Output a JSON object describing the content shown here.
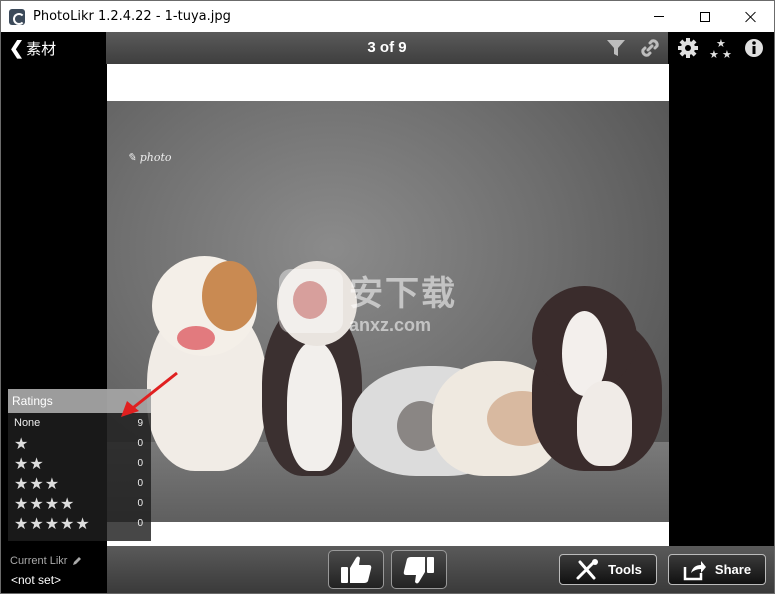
{
  "window": {
    "title": "PhotoLikr 1.2.4.22 - 1-tuya.jpg"
  },
  "toolbar": {
    "back_label": "素材",
    "counter": "3 of 9",
    "icons": [
      "filter-icon",
      "link-icon",
      "gear-icon",
      "stars-icon",
      "info-icon"
    ]
  },
  "photo": {
    "watermark_cn": "安下载",
    "watermark_en": "anxz.com"
  },
  "ratings": {
    "title": "Ratings",
    "rows": [
      {
        "label": "None",
        "stars": "",
        "count": "9"
      },
      {
        "label": "",
        "stars": "★",
        "count": "0"
      },
      {
        "label": "",
        "stars": "★★",
        "count": "0"
      },
      {
        "label": "",
        "stars": "★★★",
        "count": "0"
      },
      {
        "label": "",
        "stars": "★★★★",
        "count": "0"
      },
      {
        "label": "",
        "stars": "★★★★★",
        "count": "0"
      }
    ]
  },
  "bottombar": {
    "current_likr_label": "Current Likr",
    "current_likr_value": "<not set>",
    "tools_label": "Tools",
    "share_label": "Share"
  },
  "colors": {
    "toolbar_bg": "#4a4a4a",
    "annotation_arrow": "#e02020"
  }
}
